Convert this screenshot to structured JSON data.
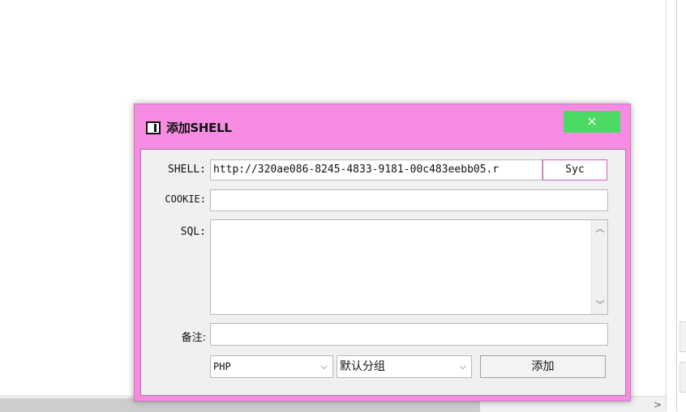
{
  "dialog": {
    "title": "添加SHELL",
    "close_glyph": "×",
    "labels": {
      "shell": "SHELL:",
      "cookie": "COOKIE:",
      "sql": "SQL:",
      "note": "备注:"
    },
    "shell_value": "http://320ae086-8245-4833-9181-00c483eebb05.r",
    "sync_label": "Syc",
    "cookie_value": "",
    "sql_value": "",
    "note_value": "",
    "type_select": "PHP",
    "group_select": "默认分组",
    "add_label": "添加"
  },
  "icons": {
    "dropdown": "⌵",
    "scroll_up": "︿",
    "scroll_down": "﹀",
    "scroll_right": ">"
  },
  "colors": {
    "dialog_frame": "#f78de3",
    "close_button": "#4cd964"
  }
}
